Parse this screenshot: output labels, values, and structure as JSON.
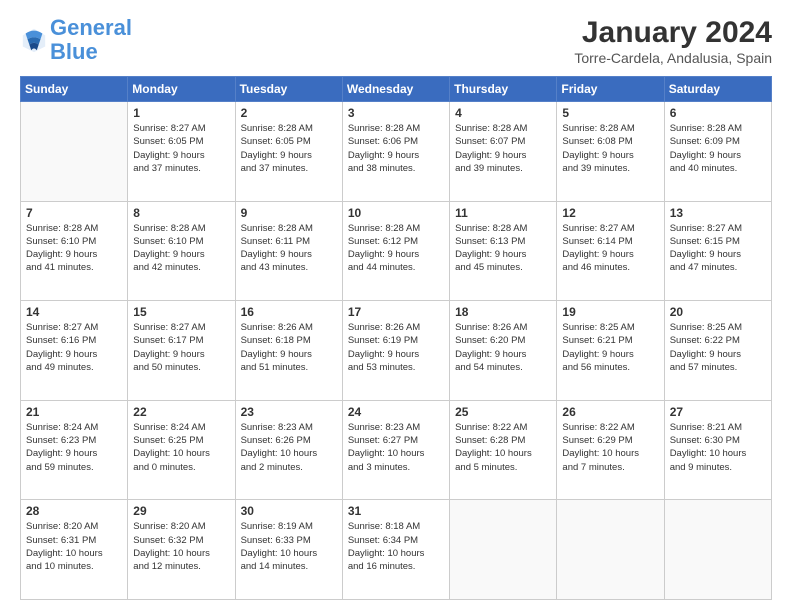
{
  "logo": {
    "line1": "General",
    "line2": "Blue"
  },
  "title": "January 2024",
  "location": "Torre-Cardela, Andalusia, Spain",
  "days_of_week": [
    "Sunday",
    "Monday",
    "Tuesday",
    "Wednesday",
    "Thursday",
    "Friday",
    "Saturday"
  ],
  "weeks": [
    [
      {
        "day": "",
        "info": ""
      },
      {
        "day": "1",
        "info": "Sunrise: 8:27 AM\nSunset: 6:05 PM\nDaylight: 9 hours\nand 37 minutes."
      },
      {
        "day": "2",
        "info": "Sunrise: 8:28 AM\nSunset: 6:05 PM\nDaylight: 9 hours\nand 37 minutes."
      },
      {
        "day": "3",
        "info": "Sunrise: 8:28 AM\nSunset: 6:06 PM\nDaylight: 9 hours\nand 38 minutes."
      },
      {
        "day": "4",
        "info": "Sunrise: 8:28 AM\nSunset: 6:07 PM\nDaylight: 9 hours\nand 39 minutes."
      },
      {
        "day": "5",
        "info": "Sunrise: 8:28 AM\nSunset: 6:08 PM\nDaylight: 9 hours\nand 39 minutes."
      },
      {
        "day": "6",
        "info": "Sunrise: 8:28 AM\nSunset: 6:09 PM\nDaylight: 9 hours\nand 40 minutes."
      }
    ],
    [
      {
        "day": "7",
        "info": "Sunrise: 8:28 AM\nSunset: 6:10 PM\nDaylight: 9 hours\nand 41 minutes."
      },
      {
        "day": "8",
        "info": "Sunrise: 8:28 AM\nSunset: 6:10 PM\nDaylight: 9 hours\nand 42 minutes."
      },
      {
        "day": "9",
        "info": "Sunrise: 8:28 AM\nSunset: 6:11 PM\nDaylight: 9 hours\nand 43 minutes."
      },
      {
        "day": "10",
        "info": "Sunrise: 8:28 AM\nSunset: 6:12 PM\nDaylight: 9 hours\nand 44 minutes."
      },
      {
        "day": "11",
        "info": "Sunrise: 8:28 AM\nSunset: 6:13 PM\nDaylight: 9 hours\nand 45 minutes."
      },
      {
        "day": "12",
        "info": "Sunrise: 8:27 AM\nSunset: 6:14 PM\nDaylight: 9 hours\nand 46 minutes."
      },
      {
        "day": "13",
        "info": "Sunrise: 8:27 AM\nSunset: 6:15 PM\nDaylight: 9 hours\nand 47 minutes."
      }
    ],
    [
      {
        "day": "14",
        "info": "Sunrise: 8:27 AM\nSunset: 6:16 PM\nDaylight: 9 hours\nand 49 minutes."
      },
      {
        "day": "15",
        "info": "Sunrise: 8:27 AM\nSunset: 6:17 PM\nDaylight: 9 hours\nand 50 minutes."
      },
      {
        "day": "16",
        "info": "Sunrise: 8:26 AM\nSunset: 6:18 PM\nDaylight: 9 hours\nand 51 minutes."
      },
      {
        "day": "17",
        "info": "Sunrise: 8:26 AM\nSunset: 6:19 PM\nDaylight: 9 hours\nand 53 minutes."
      },
      {
        "day": "18",
        "info": "Sunrise: 8:26 AM\nSunset: 6:20 PM\nDaylight: 9 hours\nand 54 minutes."
      },
      {
        "day": "19",
        "info": "Sunrise: 8:25 AM\nSunset: 6:21 PM\nDaylight: 9 hours\nand 56 minutes."
      },
      {
        "day": "20",
        "info": "Sunrise: 8:25 AM\nSunset: 6:22 PM\nDaylight: 9 hours\nand 57 minutes."
      }
    ],
    [
      {
        "day": "21",
        "info": "Sunrise: 8:24 AM\nSunset: 6:23 PM\nDaylight: 9 hours\nand 59 minutes."
      },
      {
        "day": "22",
        "info": "Sunrise: 8:24 AM\nSunset: 6:25 PM\nDaylight: 10 hours\nand 0 minutes."
      },
      {
        "day": "23",
        "info": "Sunrise: 8:23 AM\nSunset: 6:26 PM\nDaylight: 10 hours\nand 2 minutes."
      },
      {
        "day": "24",
        "info": "Sunrise: 8:23 AM\nSunset: 6:27 PM\nDaylight: 10 hours\nand 3 minutes."
      },
      {
        "day": "25",
        "info": "Sunrise: 8:22 AM\nSunset: 6:28 PM\nDaylight: 10 hours\nand 5 minutes."
      },
      {
        "day": "26",
        "info": "Sunrise: 8:22 AM\nSunset: 6:29 PM\nDaylight: 10 hours\nand 7 minutes."
      },
      {
        "day": "27",
        "info": "Sunrise: 8:21 AM\nSunset: 6:30 PM\nDaylight: 10 hours\nand 9 minutes."
      }
    ],
    [
      {
        "day": "28",
        "info": "Sunrise: 8:20 AM\nSunset: 6:31 PM\nDaylight: 10 hours\nand 10 minutes."
      },
      {
        "day": "29",
        "info": "Sunrise: 8:20 AM\nSunset: 6:32 PM\nDaylight: 10 hours\nand 12 minutes."
      },
      {
        "day": "30",
        "info": "Sunrise: 8:19 AM\nSunset: 6:33 PM\nDaylight: 10 hours\nand 14 minutes."
      },
      {
        "day": "31",
        "info": "Sunrise: 8:18 AM\nSunset: 6:34 PM\nDaylight: 10 hours\nand 16 minutes."
      },
      {
        "day": "",
        "info": ""
      },
      {
        "day": "",
        "info": ""
      },
      {
        "day": "",
        "info": ""
      }
    ]
  ]
}
